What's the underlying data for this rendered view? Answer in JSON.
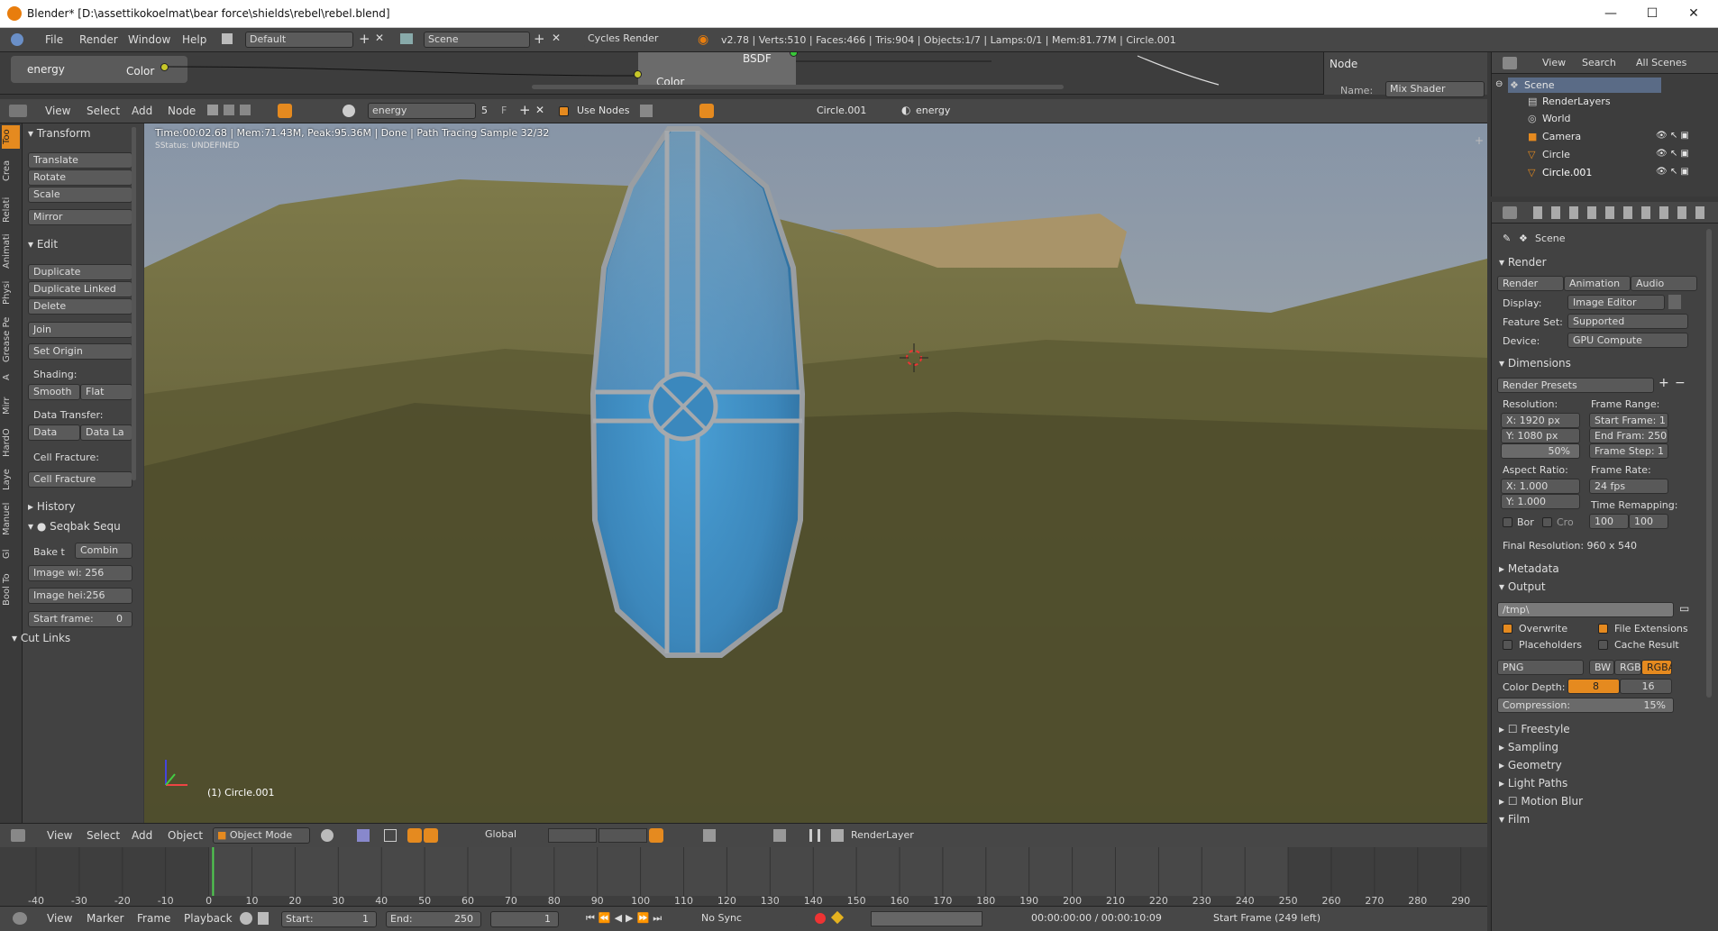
{
  "window": {
    "title": "Blender* [D:\\assettikokoelmat\\bear force\\shields\\rebel\\rebel.blend]",
    "min": "—",
    "max": "☐",
    "close": "✕"
  },
  "infobar": {
    "menus": [
      "File",
      "Render",
      "Window",
      "Help"
    ],
    "layout": "Default",
    "scene": "Scene",
    "engine": "Cycles Render",
    "stats": "v2.78 | Verts:510 | Faces:466 | Tris:904 | Objects:1/7 | Lamps:0/1 | Mem:81.77M | Circle.001"
  },
  "nodes": {
    "energy_label": "energy",
    "color_label": "Color",
    "bsdf_label": "BSDF",
    "color2_label": "Color",
    "panel_title": "Node",
    "name_label": "Name:",
    "name_value": "Mix Shader"
  },
  "node_header": {
    "menus": [
      "View",
      "Select",
      "Add",
      "Node"
    ],
    "material": "energy",
    "users": "5",
    "fake": "F",
    "use_nodes": "Use Nodes",
    "object": "Circle.001",
    "material2": "energy"
  },
  "left_tabs": [
    "Too",
    "Crea",
    "Relati",
    "Animati",
    "Physi",
    "Grease Pe",
    "A",
    "Mirr",
    "HardO",
    "Laye",
    "Manuel",
    "Gl",
    "Bool To"
  ],
  "toolshelf": {
    "transform": "Transform",
    "translate": "Translate",
    "rotate": "Rotate",
    "scale": "Scale",
    "mirror": "Mirror",
    "edit": "Edit",
    "duplicate": "Duplicate",
    "duplicate_linked": "Duplicate Linked",
    "delete": "Delete",
    "join": "Join",
    "set_origin": "Set Origin",
    "shading": "Shading:",
    "smooth": "Smooth",
    "flat": "Flat",
    "data_transfer": "Data Transfer:",
    "data": "Data",
    "data_la": "Data La",
    "cell_fracture_lbl": "Cell Fracture:",
    "cell_fracture": "Cell Fracture",
    "history": "History",
    "seqbak": "Seqbak Sequ",
    "bake_t": "Bake t",
    "combin": "Combin",
    "image_wi": "Image wi: 256",
    "image_hei": "Image hei:256",
    "start_frame": "Start frame:",
    "start_frame_val": "0",
    "cut_links": "Cut Links"
  },
  "viewport": {
    "render_info": "Time:00:02.68 | Mem:71.43M, Peak:95.36M | Done | Path Tracing Sample 32/32",
    "status": "SStatus: UNDEFINED",
    "object_label": "(1) Circle.001"
  },
  "view3d_header": {
    "menus": [
      "View",
      "Select",
      "Add",
      "Object"
    ],
    "mode": "Object Mode",
    "orientation": "Global",
    "render_layer": "RenderLayer"
  },
  "timeline": {
    "ticks": [
      "-40",
      "-30",
      "-20",
      "-10",
      "0",
      "10",
      "20",
      "30",
      "40",
      "50",
      "60",
      "70",
      "80",
      "90",
      "100",
      "110",
      "120",
      "130",
      "140",
      "150",
      "160",
      "170",
      "180",
      "190",
      "200",
      "210",
      "220",
      "230",
      "240",
      "250",
      "260",
      "270",
      "280",
      "290"
    ],
    "current_frame": 1,
    "start_range": 0,
    "end_range": 250
  },
  "timeline_header": {
    "menus": [
      "View",
      "Marker",
      "Frame",
      "Playback"
    ],
    "start_label": "Start:",
    "start_val": "1",
    "end_label": "End:",
    "end_val": "250",
    "frame_val": "1",
    "sync": "No Sync",
    "time": "00:00:00:00 / 00:00:10:09",
    "status": "Start Frame (249 left)"
  },
  "outliner": {
    "tabs": [
      "View",
      "Search",
      "All Scenes"
    ],
    "items": [
      {
        "label": "Scene",
        "depth": 0
      },
      {
        "label": "RenderLayers",
        "depth": 1
      },
      {
        "label": "World",
        "depth": 1
      },
      {
        "label": "Camera",
        "depth": 1
      },
      {
        "label": "Circle",
        "depth": 1
      },
      {
        "label": "Circle.001",
        "depth": 1
      }
    ]
  },
  "properties": {
    "context": "Scene",
    "render_section": "Render",
    "render_btn": "Render",
    "animation_btn": "Animation",
    "audio_btn": "Audio",
    "display_label": "Display:",
    "display_val": "Image Editor",
    "featureset_label": "Feature Set:",
    "featureset_val": "Supported",
    "device_label": "Device:",
    "device_val": "GPU Compute",
    "dimensions": "Dimensions",
    "render_presets": "Render Presets",
    "resolution_label": "Resolution:",
    "res_x": "X:     1920 px",
    "res_y": "Y:     1080 px",
    "res_pct": "50%",
    "frame_range_label": "Frame Range:",
    "start_frame": "Start Frame: 1",
    "end_frame": "End Fram: 250",
    "frame_step": "Frame Step: 1",
    "aspect_label": "Aspect Ratio:",
    "aspect_x": "X:           1.000",
    "aspect_y": "Y:           1.000",
    "frame_rate_label": "Frame Rate:",
    "fps": "24 fps",
    "time_remap": "Time Remapping:",
    "remap_old": "100",
    "remap_new": "100",
    "bor": "Bor",
    "cro": "Cro",
    "final_res": "Final Resolution: 960 x 540",
    "metadata": "Metadata",
    "output": "Output",
    "output_path": "/tmp\\",
    "overwrite": "Overwrite",
    "file_ext": "File Extensions",
    "placeholders": "Placeholders",
    "cache": "Cache Result",
    "format": "PNG",
    "bw": "BW",
    "rgb": "RGB",
    "rgba": "RGBA",
    "color_depth_label": "Color Depth:",
    "depth8": "8",
    "depth16": "16",
    "compression": "Compression:",
    "compression_val": "15%",
    "freestyle": "Freestyle",
    "sampling": "Sampling",
    "geometry": "Geometry",
    "light_paths": "Light Paths",
    "motion_blur": "Motion Blur",
    "film": "Film"
  },
  "colors": {
    "accent": "#e58a1f",
    "shield_blue": "#3f8fc4",
    "rim": "#9a9ea2",
    "panel": "#424242"
  }
}
